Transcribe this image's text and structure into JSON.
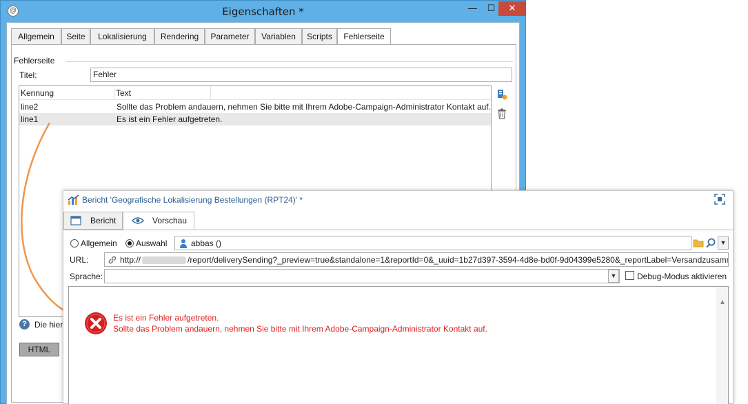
{
  "back_window": {
    "title": "Eigenschaften *",
    "controls": {
      "minimize": "—",
      "maximize": "☐",
      "close": "✕"
    },
    "tabs": [
      {
        "label": "Allgemein"
      },
      {
        "label": "Seite"
      },
      {
        "label": "Lokalisierung"
      },
      {
        "label": "Rendering"
      },
      {
        "label": "Parameter"
      },
      {
        "label": "Variablen"
      },
      {
        "label": "Scripts"
      },
      {
        "label": "Fehlerseite",
        "active": true
      }
    ],
    "group_label": "Fehlerseite",
    "titel_label": "Titel:",
    "titel_value": "Fehler",
    "grid": {
      "columns": [
        "Kennung",
        "Text"
      ],
      "rows": [
        {
          "id": "line2",
          "text": "Sollte das Problem andauern, nehmen Sie bitte mit Ihrem Adobe-Campaign-Administrator Kontakt auf.",
          "selected": false
        },
        {
          "id": "line1",
          "text": "Es ist ein Fehler aufgetreten.",
          "selected": true
        }
      ]
    },
    "side_icons": [
      "add-row-icon",
      "trash-icon"
    ],
    "help_text": "Die hier",
    "html_button": "HTML",
    "colors": {
      "frame": "#5fb0e6",
      "close": "#c74a3d"
    }
  },
  "front_window": {
    "title": "Bericht 'Geografische Lokalisierung Bestellungen (RPT24)' *",
    "tabs": [
      {
        "label": "Bericht",
        "icon": "window-icon"
      },
      {
        "label": "Vorschau",
        "icon": "eye-icon",
        "active": true
      }
    ],
    "radio": [
      {
        "label": "Allgemein",
        "selected": false
      },
      {
        "label": "Auswahl",
        "selected": true
      }
    ],
    "user_value": "abbas  ()",
    "url_label": "URL:",
    "url_prefix": "http://",
    "url_value": "/report/deliverySending?_preview=true&standalone=1&reportId=0&_uuid=1b27d397-3594-4d8e-bd0f-9d04399e5280&_reportLabel=Versandzusamme",
    "language_label": "Sprache:",
    "debug_label": "Debug-Modus aktivieren",
    "debug_checked": false,
    "error": {
      "line1": "Es ist ein Fehler aufgetreten.",
      "line2": "Sollte das Problem andauern, nehmen Sie bitte mit Ihrem Adobe-Campaign-Administrator Kontakt auf.",
      "color": "#e02020"
    }
  },
  "annotation": {
    "arrow_color": "#f0954a"
  }
}
